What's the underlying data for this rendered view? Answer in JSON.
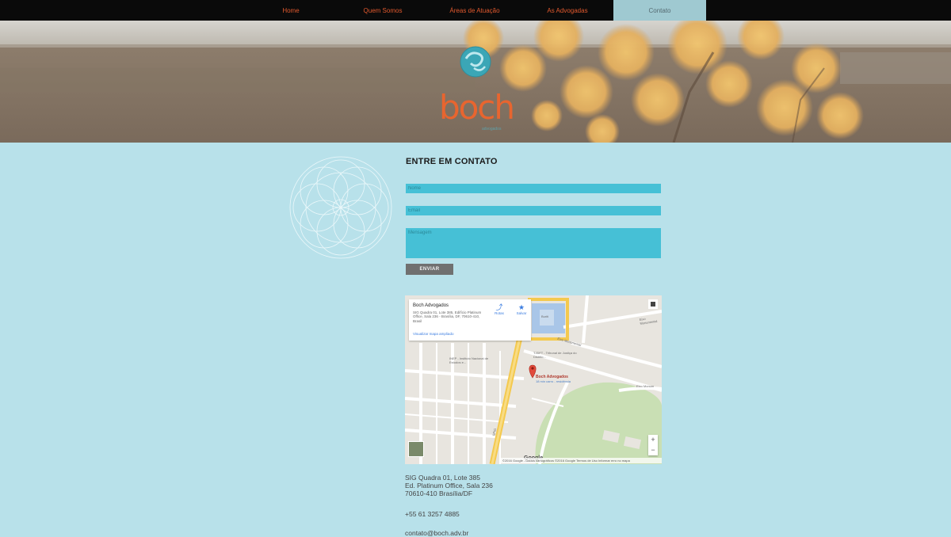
{
  "nav": {
    "items": [
      {
        "label": "Home"
      },
      {
        "label": "Quem Somos"
      },
      {
        "label": "Áreas de Atuação"
      },
      {
        "label": "As Advogadas"
      },
      {
        "label": "Contato"
      }
    ],
    "active_index": 4
  },
  "logo": {
    "word": "boch",
    "subtitle": "advogados"
  },
  "contact": {
    "title": "ENTRE EM CONTATO",
    "name_placeholder": "Nome",
    "email_placeholder": "Email",
    "message_placeholder": "Mensagem",
    "send_label": "ENVIAR"
  },
  "map": {
    "card_title": "Boch Advogados",
    "card_address": "SIG Quadra 01, Lote 385, Edifício Platinum Office, Sala 236 - Brasília, DF, 70610-410, Brasil",
    "directions_label": "Rotas",
    "save_label": "Salvar",
    "larger_map_link": "Visualizar mapa ampliado",
    "pin_label": "Boch Advogados",
    "pin_sublabel": "18 min carro - residência",
    "label_inep": "INEP - Instituto Nacional de Estudos e...",
    "label_tjdft": "TJDFT - Tribunal de Justiça do Distrito...",
    "label_eixo1": "Eixo Monumental",
    "label_eixo2": "Eixo Monum",
    "label_eixo3": "Eixo Monumental",
    "label_epig": "EPIG",
    "label_burit": "Buriti",
    "zoom_in": "+",
    "zoom_out": "−",
    "google": "Google",
    "footer": "©2016 Google - Dados cartográficos ©2016 Google   Termos de Uso   Informar erro no mapa"
  },
  "address": {
    "line1": "SIG Quadra 01, Lote 385",
    "line2": "Ed. Platinum Office, Sala 236",
    "line3": "70610-410 Brasília/DF",
    "phone": "+55 61 3257 4885",
    "email": "contato@boch.adv.br"
  },
  "colors": {
    "nav_bg": "#0a0a0a",
    "nav_text": "#e2592e",
    "nav_active_bg": "#9fc9d1",
    "page_bg": "#b8e1ea",
    "input_bg": "#46c0d6",
    "button_bg": "#707070",
    "logo_orange": "#e8652f",
    "logo_teal": "#3ba6b6"
  }
}
